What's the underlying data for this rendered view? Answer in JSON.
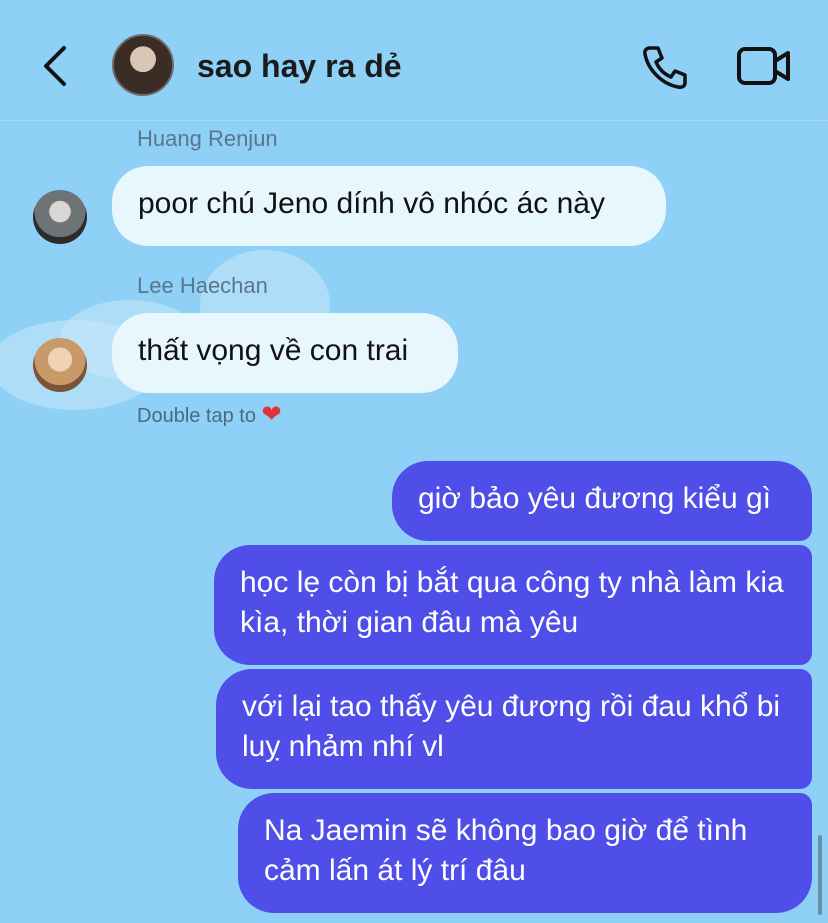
{
  "header": {
    "title": "sao hay ra dẻ",
    "back_icon": "chevron-left-icon",
    "call_icon": "phone-icon",
    "video_icon": "video-camera-icon"
  },
  "messages": [
    {
      "sender": "Huang Renjun",
      "text": "poor chú Jeno dính vô nhóc ác này",
      "direction": "incoming"
    },
    {
      "sender": "Lee Haechan",
      "text": "thất vọng về con trai",
      "direction": "incoming"
    },
    {
      "text": "giờ bảo yêu đương kiểu gì",
      "direction": "outgoing"
    },
    {
      "text": "học lẹ còn bị bắt qua công ty nhà làm kia kìa, thời gian đâu mà yêu",
      "direction": "outgoing"
    },
    {
      "text": "với lại tao thấy yêu đương rồi đau khổ bi luỵ nhảm nhí vl",
      "direction": "outgoing"
    },
    {
      "text": "Na Jaemin sẽ không bao giờ để tình cảm lấn át lý trí đâu",
      "direction": "outgoing"
    }
  ],
  "hint": {
    "text": "Double tap to",
    "icon": "heart-icon"
  },
  "colors": {
    "background": "#8fd0f7",
    "outgoing_bubble": "#4f4ee9",
    "incoming_bubble": "#e8f6fd"
  }
}
